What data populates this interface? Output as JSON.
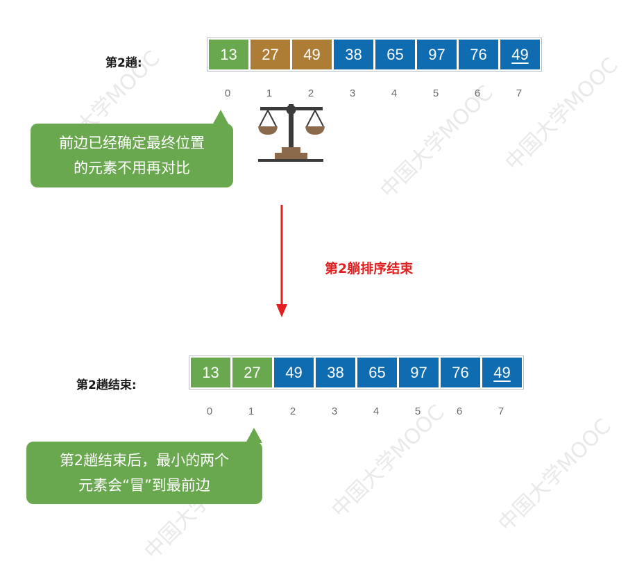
{
  "pass2": {
    "label": "第2趟:",
    "cells": [
      {
        "value": "13",
        "color": "green"
      },
      {
        "value": "27",
        "color": "brown"
      },
      {
        "value": "49",
        "color": "brown"
      },
      {
        "value": "38",
        "color": "blue"
      },
      {
        "value": "65",
        "color": "blue"
      },
      {
        "value": "97",
        "color": "blue"
      },
      {
        "value": "76",
        "color": "blue"
      },
      {
        "value": "49",
        "color": "blue",
        "underline": true
      }
    ],
    "indices": [
      "0",
      "1",
      "2",
      "3",
      "4",
      "5",
      "6",
      "7"
    ],
    "bubble_lines": [
      "前边已经确定最终位置",
      "的元素不用再对比"
    ]
  },
  "transition_text": "第2躺排序结束",
  "pass2_end": {
    "label": "第2趟结束:",
    "cells": [
      {
        "value": "13",
        "color": "green"
      },
      {
        "value": "27",
        "color": "green"
      },
      {
        "value": "49",
        "color": "blue"
      },
      {
        "value": "38",
        "color": "blue"
      },
      {
        "value": "65",
        "color": "blue"
      },
      {
        "value": "97",
        "color": "blue"
      },
      {
        "value": "76",
        "color": "blue"
      },
      {
        "value": "49",
        "color": "blue",
        "underline": true
      }
    ],
    "indices": [
      "0",
      "1",
      "2",
      "3",
      "4",
      "5",
      "6",
      "7"
    ],
    "bubble_lines": [
      "第2趟结束后，最小的两个",
      "元素会“冒”到最前边"
    ]
  },
  "colors": {
    "green": "#6aa84f",
    "brown": "#ad7d35",
    "blue": "#0f6cb0",
    "arrow": "#e02020"
  },
  "icons": [
    "balance-scale-icon",
    "down-arrow-icon"
  ]
}
